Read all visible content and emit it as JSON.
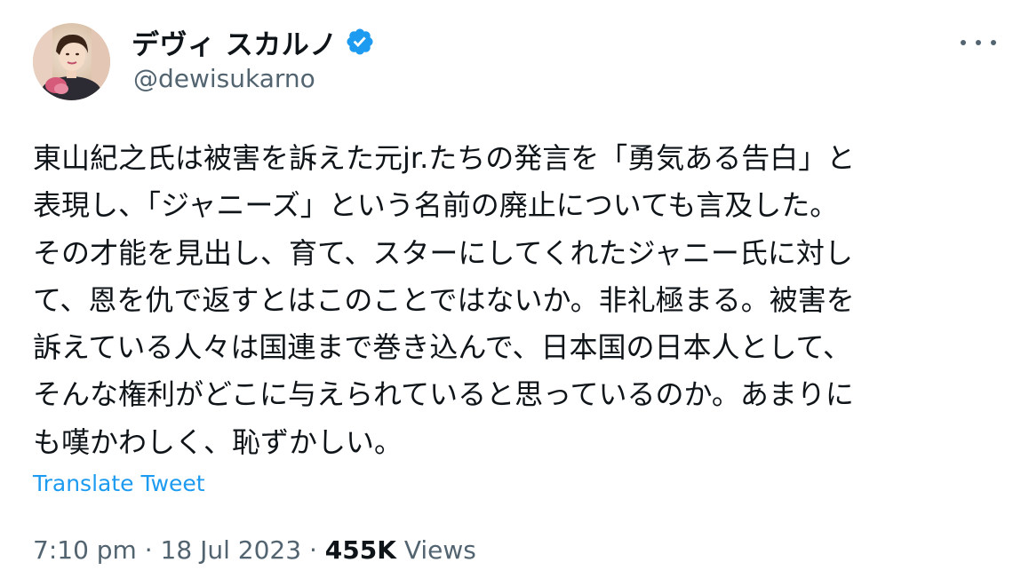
{
  "author": {
    "display_name": "デヴィ スカルノ",
    "handle": "@dewisukarno",
    "verified": true,
    "avatar_icon": "profile-photo"
  },
  "tweet": {
    "lines": [
      "東山紀之氏は被害を訴えた元jr.たちの発言を「勇気ある告白」と",
      "表現し、「ジャニーズ」という名前の廃止についても言及した。",
      "その才能を見出し、育て、スターにしてくれたジャニー氏に対し",
      "て、恩を仇で返すとはこのことではないか。非礼極まる。被害を",
      "訴えている人々は国連まで巻き込んで、日本国の日本人として、",
      "そんな権利がどこに与えられていると思っているのか。あまりに",
      "も嘆かわしく、恥ずかしい。"
    ],
    "translate_label": "Translate Tweet",
    "time": "7:10 pm",
    "separator": "·",
    "date": "18 Jul 2023",
    "views_count": "455K",
    "views_label": "Views"
  },
  "colors": {
    "text_primary": "#0f1419",
    "text_secondary": "#536471",
    "accent": "#1d9bf0"
  }
}
